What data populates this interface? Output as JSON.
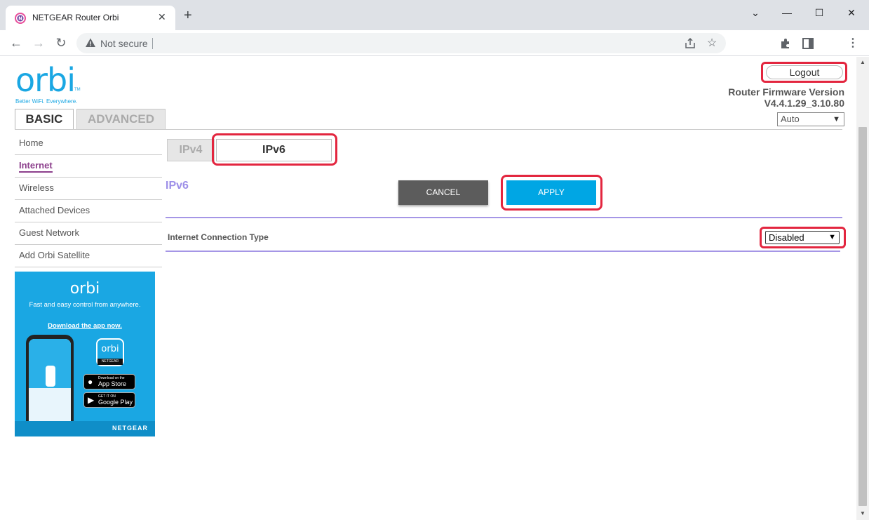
{
  "browser": {
    "tab_title": "NETGEAR Router Orbi",
    "tab_close": "✕",
    "new_tab": "+",
    "minimize": "—",
    "maximize": "☐",
    "close": "✕",
    "address_security": "Not secure",
    "back": "←",
    "forward": "→",
    "reload": "↻"
  },
  "header": {
    "logo_text": "orbi",
    "logo_tm": "TM",
    "tagline": "Better WiFi. Everywhere.",
    "logout_label": "Logout",
    "firmware_label": "Router Firmware Version",
    "firmware_version": "V4.4.1.29_3.10.80",
    "language_selected": "Auto"
  },
  "main_tabs": {
    "basic": "BASIC",
    "advanced": "ADVANCED"
  },
  "sidebar": {
    "items": [
      {
        "label": "Home"
      },
      {
        "label": "Internet"
      },
      {
        "label": "Wireless"
      },
      {
        "label": "Attached Devices"
      },
      {
        "label": "Guest Network"
      },
      {
        "label": "Add Orbi Satellite"
      }
    ]
  },
  "promo": {
    "logo": "orbi",
    "text": "Fast and easy control from anywhere.",
    "link": "Download the app now.",
    "app_icon_text": "orbi",
    "app_icon_brand": "NETGEAR",
    "appstore_small": "Download on the",
    "appstore_big": "App Store",
    "googleplay_small": "GET IT ON",
    "googleplay_big": "Google Play",
    "brand": "NETGEAR"
  },
  "content": {
    "sub_tabs": {
      "ipv4": "IPv4",
      "ipv6": "IPv6"
    },
    "section_title": "IPv6",
    "cancel_label": "CANCEL",
    "apply_label": "APPLY",
    "connection_type_label": "Internet Connection Type",
    "connection_type_value": "Disabled"
  },
  "colors": {
    "accent": "#1aa7e3",
    "apply": "#00a6e4",
    "highlight": "#e3263f",
    "rule": "#a596e6",
    "active_nav": "#8c3f8c"
  }
}
